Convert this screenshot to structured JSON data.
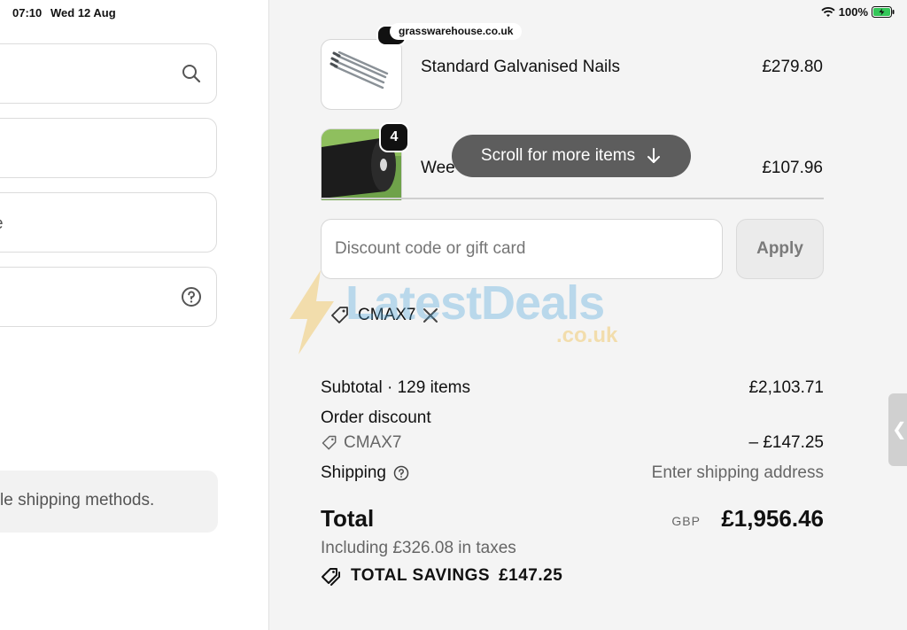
{
  "status_bar": {
    "time": "07:10",
    "date": "Wed 12 Aug",
    "battery": "100%",
    "url": "grasswarehouse.co.uk"
  },
  "left_panel": {
    "field_partial_text": "e",
    "shipping_note": "le shipping methods."
  },
  "items": [
    {
      "name": "Standard Galvanised Nails",
      "price": "£279.80",
      "image": "galvanised-nails"
    },
    {
      "name": "Wee",
      "price": "£107.96",
      "quantity": "4",
      "image": "weed-membrane-roll"
    }
  ],
  "scroll_hint": {
    "label": "Scroll for more items"
  },
  "discount": {
    "placeholder": "Discount code or gift card",
    "apply_label": "Apply",
    "applied_code": "CMAX7"
  },
  "summary": {
    "subtotal_label": "Subtotal · 129 items",
    "subtotal_value": "£2,103.71",
    "order_discount_label": "Order discount",
    "discount_code": "CMAX7",
    "discount_value": "– £147.25",
    "shipping_label": "Shipping",
    "shipping_value": "Enter shipping address",
    "total_label": "Total",
    "currency": "GBP",
    "total_value": "£1,956.46",
    "taxes_note": "Including £326.08 in taxes",
    "savings_label": "TOTAL SAVINGS",
    "savings_value": "£147.25"
  },
  "watermark": {
    "text": "LatestDeals",
    "sub": ".co.uk"
  },
  "colors": {
    "accent_dark": "#111111",
    "pill": "#5d5d5d",
    "panel_bg": "#f4f4f4"
  }
}
